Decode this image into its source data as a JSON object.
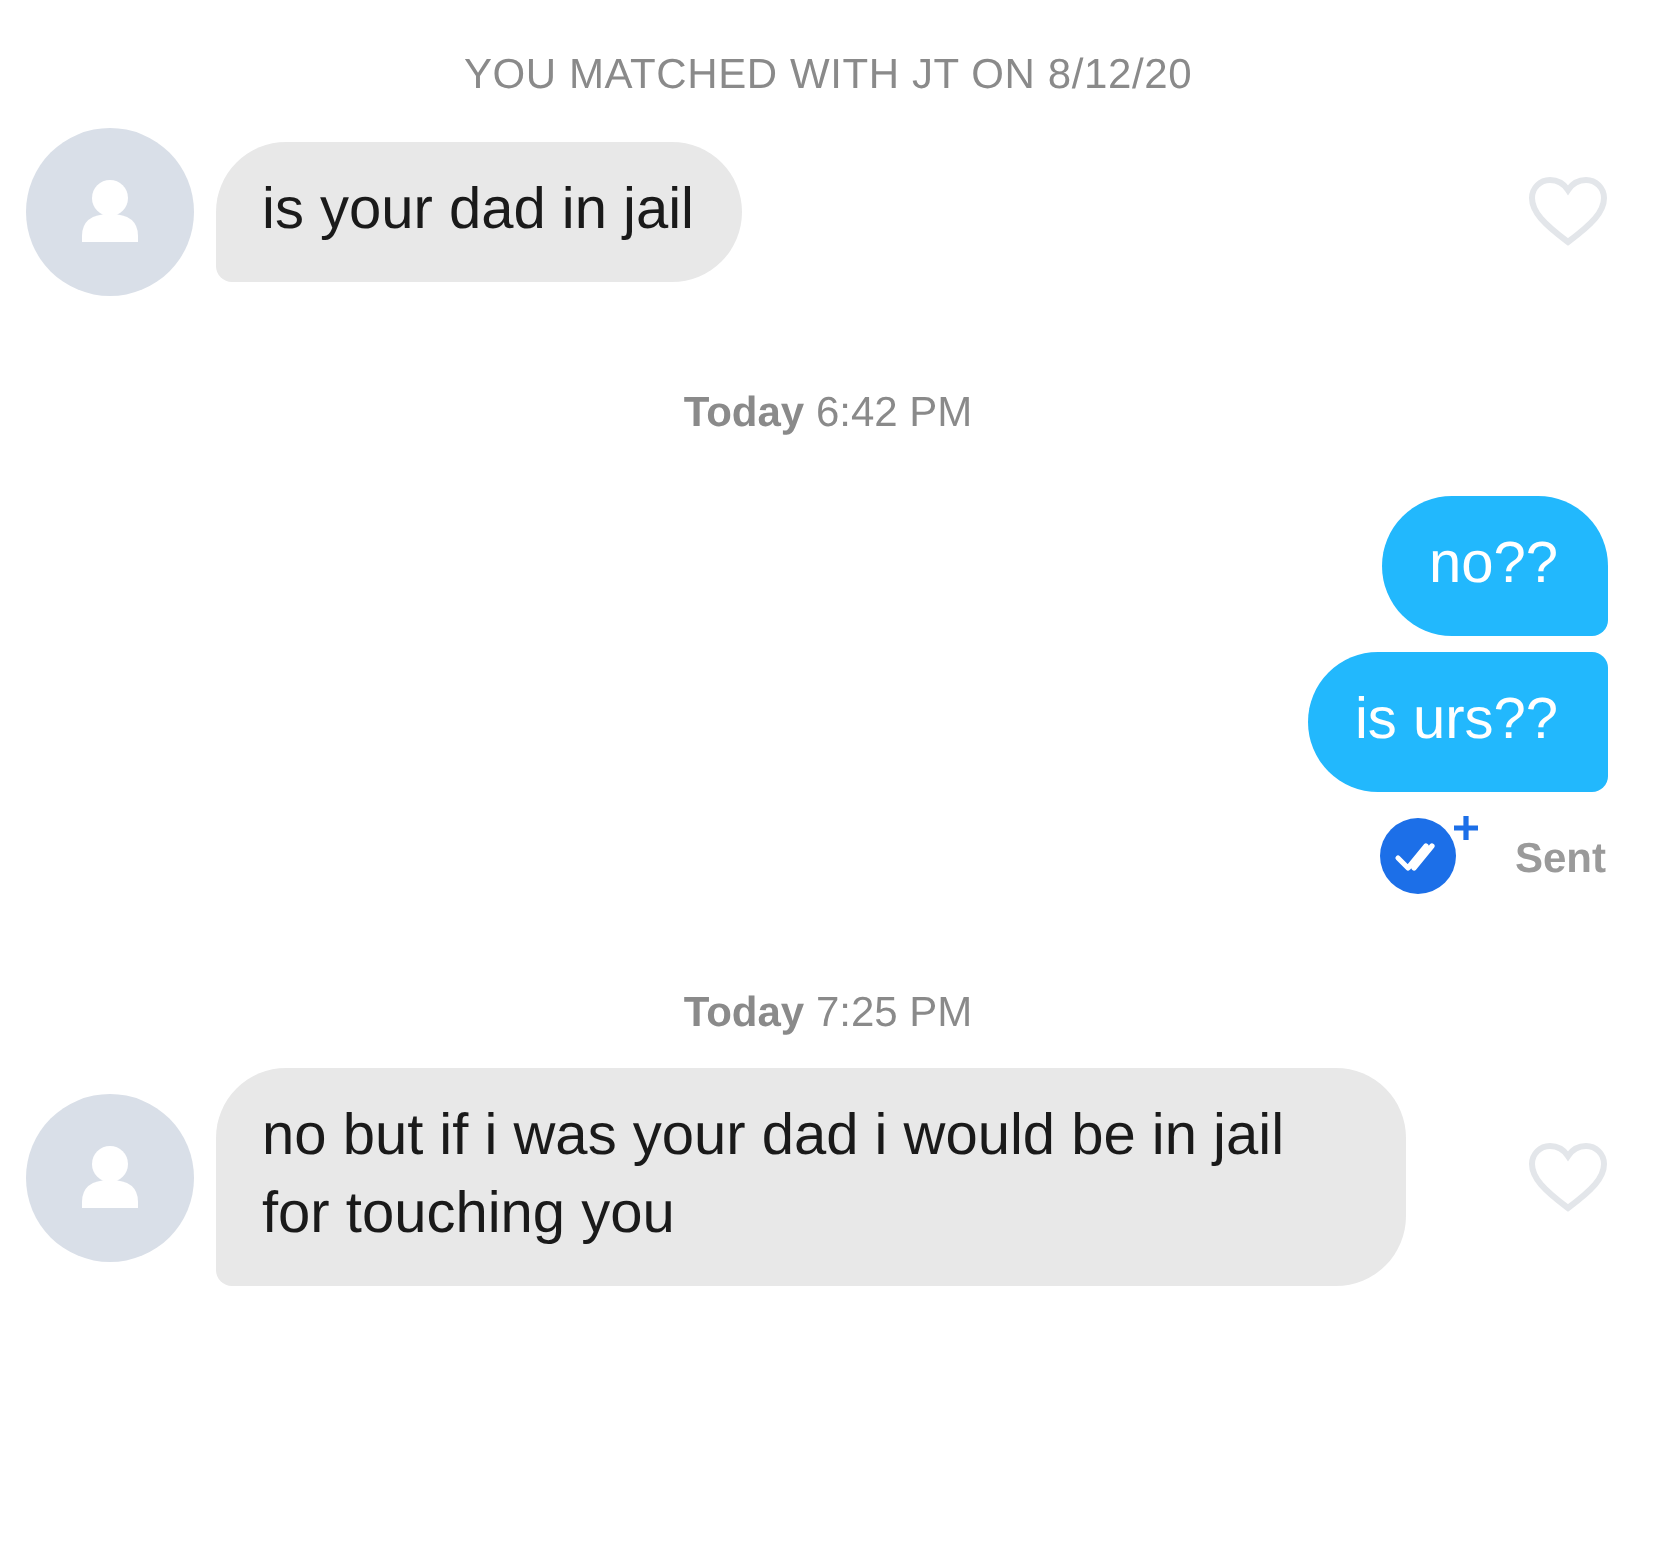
{
  "header": "YOU MATCHED WITH JT ON 8/12/20",
  "thread": [
    {
      "kind": "incoming",
      "text": "is your dad in jail",
      "liked": false
    },
    {
      "kind": "timestamp",
      "text": "**Today** 6:42 PM"
    },
    {
      "kind": "outgoing",
      "text": "no??"
    },
    {
      "kind": "outgoing",
      "text": "is urs??"
    },
    {
      "kind": "status",
      "text": "Sent"
    },
    {
      "kind": "timestamp",
      "text": "**Today** 7:25 PM"
    },
    {
      "kind": "incoming",
      "text": "no but if i was your dad i would be in jail for touching you",
      "liked": false
    }
  ]
}
